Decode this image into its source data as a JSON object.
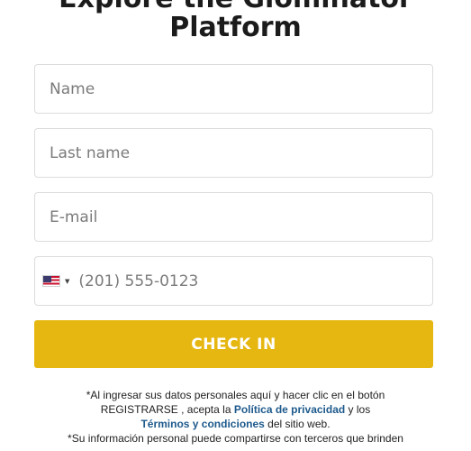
{
  "header": {
    "title_line1": "Explore the Glominator",
    "title_line2": "Platform"
  },
  "form": {
    "name_placeholder": "Name",
    "last_name_placeholder": "Last name",
    "email_placeholder": "E-mail",
    "phone_placeholder": "(201) 555-0123",
    "country_flag": "us-flag-icon",
    "submit_label": "CHECK IN"
  },
  "legal": {
    "line1": "*Al ingresar sus datos personales aquí y hacer clic en el botón",
    "line2_pre": "REGISTRARSE , acepta la ",
    "privacy_link": "Política de privacidad",
    "line2_post": " y los",
    "terms_link": "Términos y condiciones",
    "line3_post": " del sitio web.",
    "line4": "*Su información personal puede compartirse con terceros que brinden"
  },
  "colors": {
    "button": "#e6b711",
    "link": "#1e5a8c"
  }
}
